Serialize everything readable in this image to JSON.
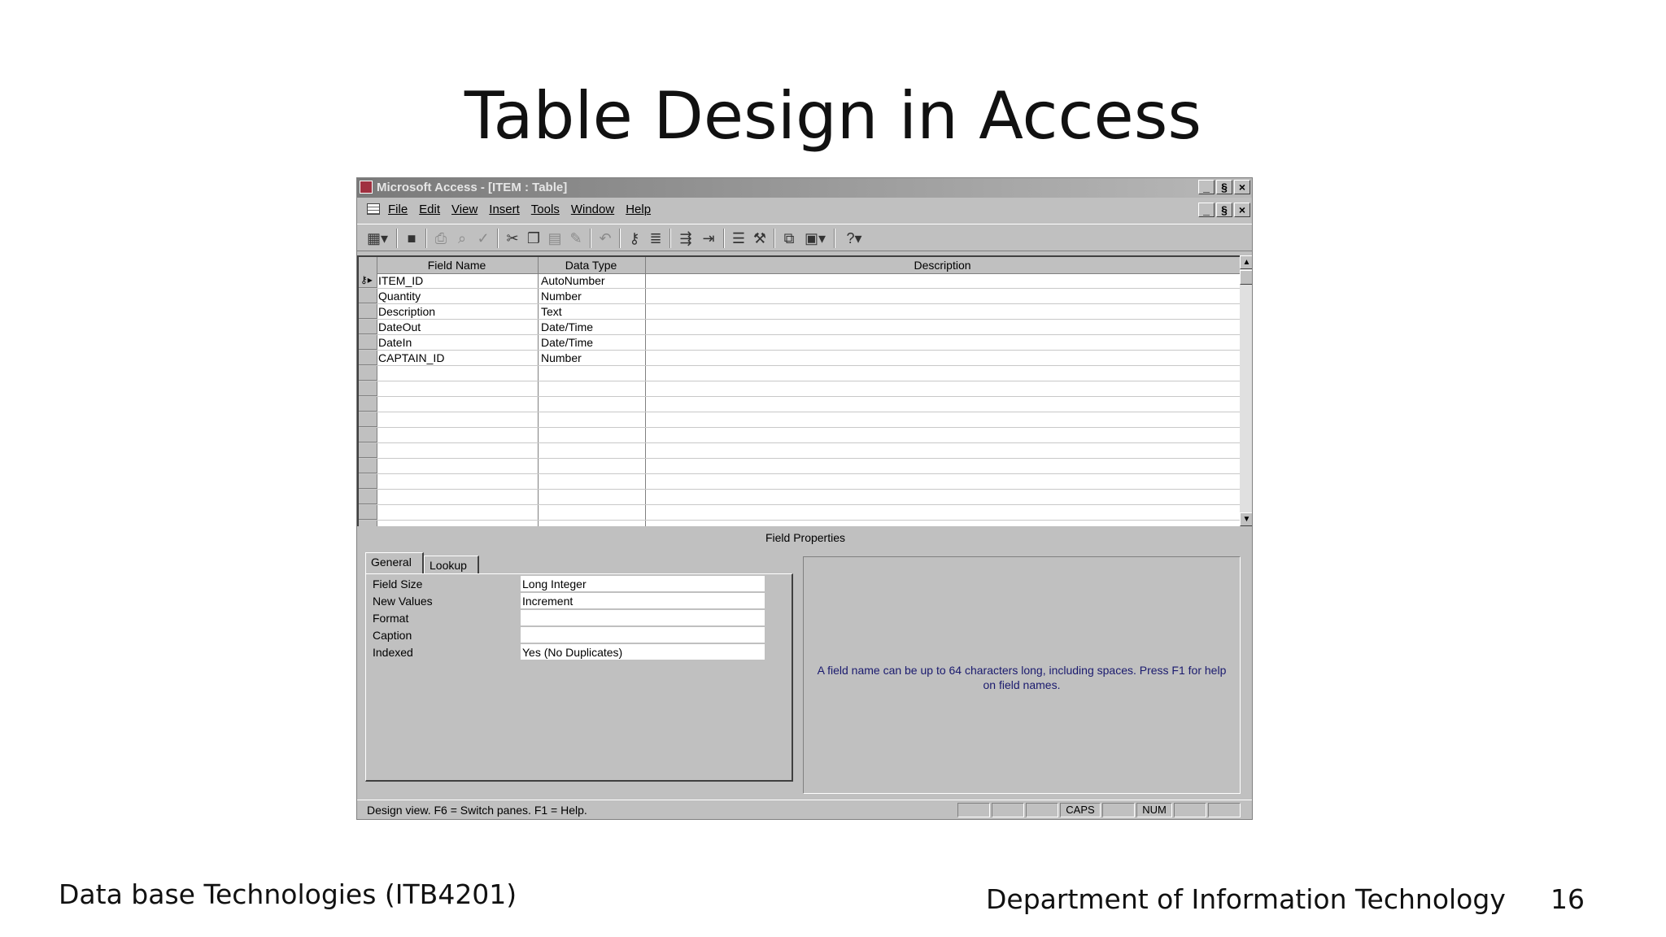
{
  "slide": {
    "title": "Table Design in Access",
    "footer_left": "Data base Technologies (ITB4201)",
    "footer_center": "Department of Information Technology",
    "page_number": "16"
  },
  "window": {
    "title": "Microsoft Access - [ITEM : Table]",
    "buttons": [
      "_",
      "§",
      "×"
    ]
  },
  "menubar": {
    "items": [
      "File",
      "Edit",
      "View",
      "Insert",
      "Tools",
      "Window",
      "Help"
    ]
  },
  "toolbar": {
    "icons": [
      "view-icon",
      "save-icon",
      "print-icon",
      "print-preview-icon",
      "spelling-icon",
      "cut-icon",
      "copy-icon",
      "paste-icon",
      "format-painter-icon",
      "undo-icon",
      "primary-key-icon",
      "indexes-icon",
      "insert-rows-icon",
      "delete-rows-icon",
      "properties-icon",
      "build-icon",
      "database-window-icon",
      "new-object-icon",
      "help-icon"
    ]
  },
  "grid": {
    "headers": [
      "Field Name",
      "Data Type",
      "Description"
    ],
    "rows": [
      {
        "field": "ITEM_ID",
        "type": "AutoNumber",
        "desc": ""
      },
      {
        "field": "Quantity",
        "type": "Number",
        "desc": ""
      },
      {
        "field": "Description",
        "type": "Text",
        "desc": ""
      },
      {
        "field": "DateOut",
        "type": "Date/Time",
        "desc": ""
      },
      {
        "field": "DateIn",
        "type": "Date/Time",
        "desc": ""
      },
      {
        "field": "CAPTAIN_ID",
        "type": "Number",
        "desc": ""
      }
    ]
  },
  "field_properties": {
    "title": "Field Properties",
    "tabs": [
      "General",
      "Lookup"
    ],
    "properties": [
      {
        "label": "Field Size",
        "value": "Long Integer"
      },
      {
        "label": "New Values",
        "value": "Increment"
      },
      {
        "label": "Format",
        "value": ""
      },
      {
        "label": "Caption",
        "value": ""
      },
      {
        "label": "Indexed",
        "value": "Yes (No Duplicates)"
      }
    ],
    "help_text": "A field name can be up to 64 characters long, including spaces.  Press F1 for help on field names."
  },
  "statusbar": {
    "text": "Design view.  F6 = Switch panes.  F1 = Help.",
    "indicators": [
      "",
      "",
      "",
      "CAPS",
      "",
      "NUM",
      "",
      ""
    ]
  }
}
